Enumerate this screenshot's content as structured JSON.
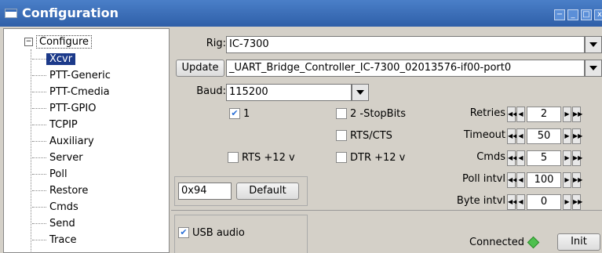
{
  "window": {
    "title": "Configuration"
  },
  "tree": {
    "root": "Configure",
    "items": [
      "Xcvr",
      "PTT-Generic",
      "PTT-Cmedia",
      "PTT-GPIO",
      "TCPIP",
      "Auxiliary",
      "Server",
      "Poll",
      "Restore",
      "Cmds",
      "Send",
      "Trace"
    ],
    "selected": "Xcvr"
  },
  "rig": {
    "label": "Rig:",
    "value": "IC-7300"
  },
  "update": {
    "button": "Update",
    "port": "_UART_Bridge_Controller_IC-7300_02013576-if00-port0"
  },
  "baud": {
    "label": "Baud:",
    "value": "115200"
  },
  "options": {
    "stop1": {
      "label": "1",
      "checked": true
    },
    "stop2": {
      "label": "2 -StopBits",
      "checked": false
    },
    "rtscts": {
      "label": "RTS/CTS",
      "checked": false
    },
    "rts12": {
      "label": "RTS +12 v",
      "checked": false
    },
    "dtr12": {
      "label": "DTR +12 v",
      "checked": false
    }
  },
  "spinners": [
    {
      "label": "Retries",
      "value": "2"
    },
    {
      "label": "Timeout",
      "value": "50"
    },
    {
      "label": "Cmds",
      "value": "5"
    },
    {
      "label": "Poll intvl",
      "value": "100"
    },
    {
      "label": "Byte intvl",
      "value": "0"
    }
  ],
  "civ": {
    "value": "0x94",
    "default_button": "Default"
  },
  "usb_audio": {
    "label": "USB audio",
    "checked": true
  },
  "status": {
    "connected_label": "Connected",
    "connected_color": "#4ec04e",
    "init_button": "Init"
  }
}
